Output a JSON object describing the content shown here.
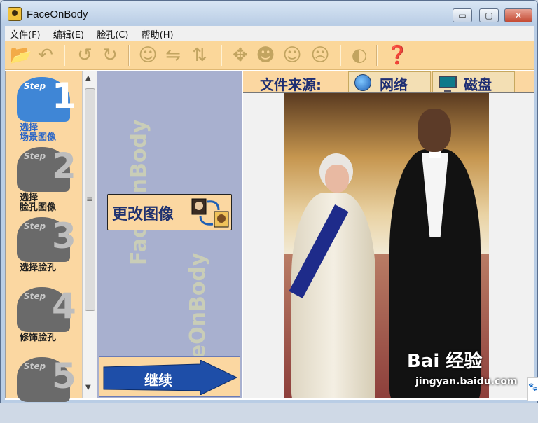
{
  "window": {
    "title": "FaceOnBody",
    "controls": {
      "minimize": "▭",
      "maximize": "▢",
      "close": "✕"
    }
  },
  "menu": [
    "文件(F)",
    "编辑(E)",
    "脸孔(C)",
    "帮助(H)"
  ],
  "toolbar": {
    "icons": [
      "open-folder-icon",
      "undo-icon",
      "rotate-left-icon",
      "rotate-right-icon",
      "face-edit-icon",
      "flip-horizontal-icon",
      "flip-vertical-icon",
      "move-icon",
      "face-adjust-icon",
      "face-tone-icon",
      "face-shape-icon",
      "face-outline-icon",
      "help-icon"
    ]
  },
  "steps": [
    {
      "label": "Step",
      "number": "1",
      "caption": "选择\n场景图像",
      "active": true
    },
    {
      "label": "Step",
      "number": "2",
      "caption": "选择\n脸孔图像",
      "active": false
    },
    {
      "label": "Step",
      "number": "3",
      "caption": "选择脸孔",
      "active": false
    },
    {
      "label": "Step",
      "number": "4",
      "caption": "修饰脸孔",
      "active": false
    },
    {
      "label": "Step",
      "number": "5",
      "caption": "",
      "active": false
    }
  ],
  "middle": {
    "watermark": "FaceOnBody",
    "change_image": "更改图像",
    "continue": "继续"
  },
  "source": {
    "label": "文件来源:",
    "network": "网络",
    "disk": "磁盘"
  },
  "watermark_text": {
    "brand": "Bai 经验",
    "url": "jingyan.baidu.com"
  },
  "colors": {
    "panel": "#fbd7a1",
    "middle": "#a8b0cf",
    "accent": "#1f2f73",
    "active_step": "#3f86d6"
  }
}
